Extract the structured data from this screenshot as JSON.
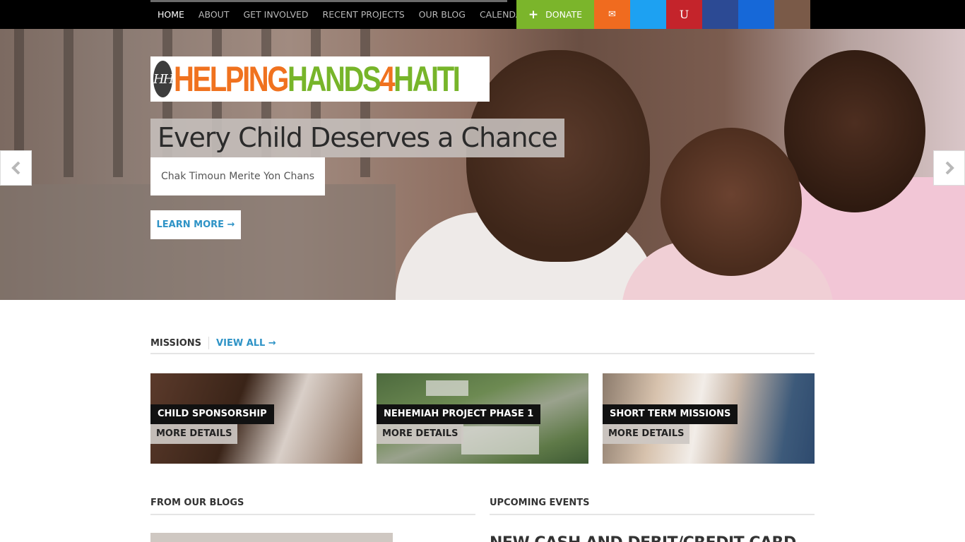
{
  "nav": {
    "items": [
      "HOME",
      "ABOUT",
      "GET INVOLVED",
      "RECENT PROJECTS",
      "OUR BLOG",
      "CALENDAR"
    ],
    "active": "HOME"
  },
  "social": {
    "donate_label": "DONATE",
    "buttons": [
      {
        "icon": "email-icon",
        "glyph": "✉",
        "color": "#f06b1f"
      },
      {
        "icon": "twitter-icon",
        "glyph": "",
        "color": "#1da1f2"
      },
      {
        "icon": "ustream-icon",
        "glyph": "U",
        "color": "#c4242b"
      },
      {
        "icon": "facebook-icon",
        "glyph": "",
        "color": "#2c4a94"
      },
      {
        "icon": "linkedin-icon",
        "glyph": "",
        "color": "#1668d8"
      },
      {
        "icon": "instagram-icon",
        "glyph": "",
        "color": "#7a5a48"
      }
    ],
    "donate_color": "#7bb52b"
  },
  "logo": {
    "mark": "HH",
    "word_orange_1": "HELPING",
    "word_green": "HANDS",
    "word_orange_2": "4",
    "word_green_2": "HAITI"
  },
  "hero": {
    "headline": "Every Child Deserves a Chance",
    "subhead": "Chak Timoun Merite Yon Chans",
    "button_label": "LEARN MORE →",
    "prev_icon": "chevron-left-icon",
    "next_icon": "chevron-right-icon"
  },
  "missions": {
    "title": "MISSIONS",
    "view_all": "VIEW ALL →",
    "cards": [
      {
        "title": "CHILD SPONSORSHIP",
        "more": "MORE DETAILS"
      },
      {
        "title": "NEHEMIAH PROJECT PHASE 1",
        "more": "MORE DETAILS"
      },
      {
        "title": "SHORT TERM MISSIONS",
        "more": "MORE DETAILS"
      }
    ]
  },
  "blogs": {
    "title": "FROM OUR BLOGS"
  },
  "events": {
    "title": "UPCOMING EVENTS",
    "first_event": "NEW CASH AND DEBIT/CREDIT CARD"
  },
  "colors": {
    "accent_blue": "#2e93c6",
    "orange": "#f0721f",
    "green": "#77b52a"
  }
}
